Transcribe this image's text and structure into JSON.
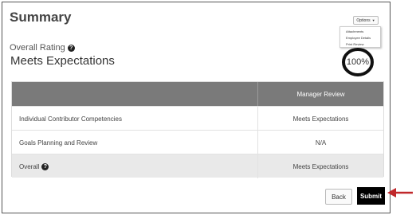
{
  "page": {
    "title": "Summary"
  },
  "options": {
    "label": "Options",
    "caret_icon": "caret-down-icon",
    "menu_items": [
      "Attachments",
      "Employee Details",
      "Print Review"
    ]
  },
  "rating": {
    "label": "Overall Rating",
    "value": "Meets Expectations",
    "help_icon": "question-circle-icon"
  },
  "gauge": {
    "text": "100%",
    "percent": 100
  },
  "table": {
    "header": {
      "name": "",
      "manager": "Manager Review"
    },
    "rows": [
      {
        "name": "Individual Contributor Competencies",
        "value": "Meets Expectations"
      },
      {
        "name": "Goals Planning and Review",
        "value": "N/A"
      },
      {
        "name": "Overall",
        "value": "Meets Expectations"
      }
    ]
  },
  "actions": {
    "back_label": "Back",
    "submit_label": "Submit"
  },
  "colors": {
    "header_bg": "#7a7a7a",
    "submit_bg": "#000000",
    "pointer_arrow": "#c0282b"
  }
}
